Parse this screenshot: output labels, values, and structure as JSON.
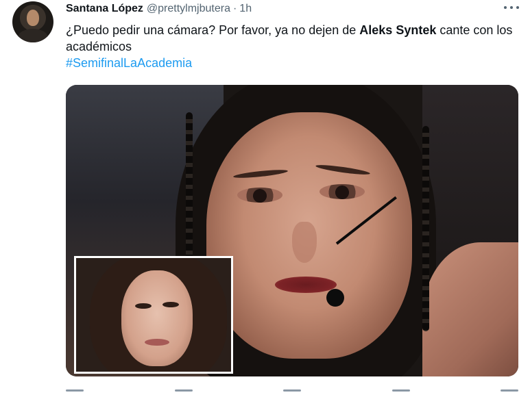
{
  "tweet": {
    "display_name": "Santana López",
    "handle": "@prettylmjbutera",
    "separator": "·",
    "time": "1h",
    "text_before": "¿Puedo pedir una cámara? Por favor, ya no dejen de ",
    "text_bold": "Aleks Syntek",
    "text_after": " cante con los académicos",
    "hashtag": "#SemifinalLaAcademia",
    "more_icon": "more-horizontal-icon"
  },
  "colors": {
    "accent": "#1d9bf0",
    "text": "#0f1419",
    "muted": "#536471"
  }
}
